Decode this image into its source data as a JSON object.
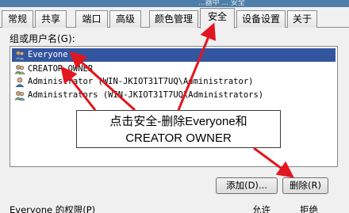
{
  "window": {
    "title_fragment": "...器中 ... 安全"
  },
  "tabs": [
    {
      "label": "常规"
    },
    {
      "label": "共享"
    },
    {
      "label": "端口"
    },
    {
      "label": "高级"
    },
    {
      "label": "颜色管理"
    },
    {
      "label": "安全",
      "active": true
    },
    {
      "label": "设备设置"
    },
    {
      "label": "关于"
    }
  ],
  "security": {
    "group_label": "组或用户名(G):",
    "users": [
      {
        "name": "Everyone",
        "selected": true
      },
      {
        "name": "CREATOR OWNER"
      },
      {
        "name": "Administrator (WIN-JKIOT31T7UQ\\Administrator)"
      },
      {
        "name": "Administrators (WIN-JKIOT31T7UQ\\Administrators)"
      }
    ],
    "add_button": "添加(D)...",
    "remove_button": "删除(R)",
    "permissions_label": "Everyone 的权限(P)",
    "allow_header": "允许",
    "deny_header": "拒绝"
  },
  "annotation": {
    "line1": "点击安全-删除Everyone和",
    "line2": "CREATOR OWNER",
    "arrow_color": "#e2161e"
  }
}
